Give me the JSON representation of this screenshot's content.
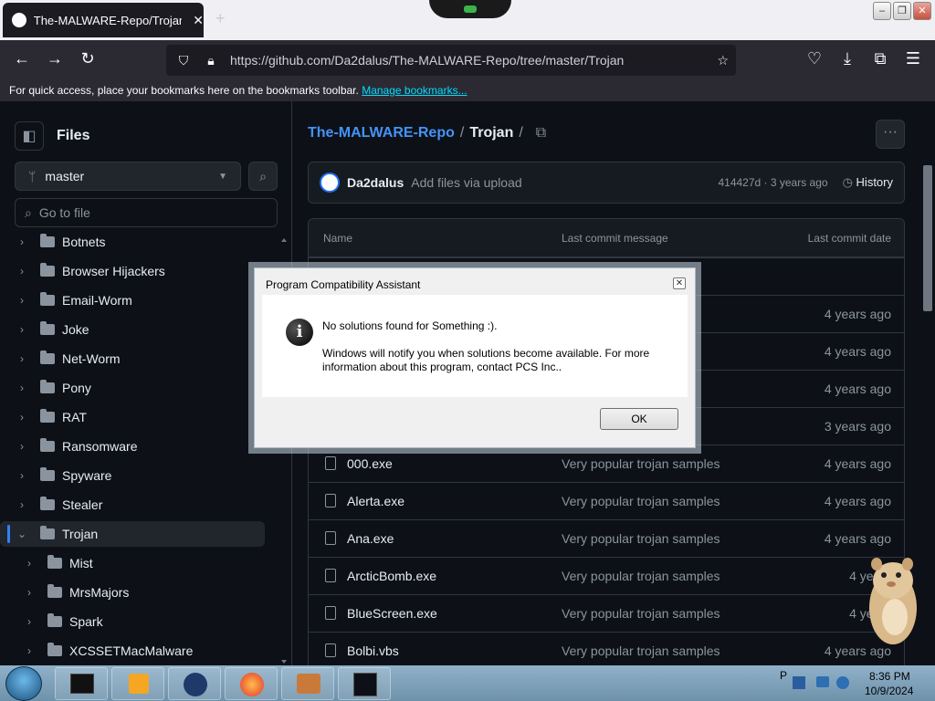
{
  "browser": {
    "tab_title": "The-MALWARE-Repo/Trojan at",
    "new_tab_symbol": "+",
    "url": "https://github.com/Da2dalus/The-MALWARE-Repo/tree/master/Trojan",
    "bookmarks_text": "For quick access, place your bookmarks here on the bookmarks toolbar.",
    "bookmarks_link": "Manage bookmarks..."
  },
  "sidebar": {
    "title": "Files",
    "branch": "master",
    "goto_placeholder": "Go to file",
    "items": [
      {
        "label": "Botnets",
        "depth": 0
      },
      {
        "label": "Browser Hijackers",
        "depth": 0
      },
      {
        "label": "Email-Worm",
        "depth": 0
      },
      {
        "label": "Joke",
        "depth": 0
      },
      {
        "label": "Net-Worm",
        "depth": 0
      },
      {
        "label": "Pony",
        "depth": 0
      },
      {
        "label": "RAT",
        "depth": 0
      },
      {
        "label": "Ransomware",
        "depth": 0
      },
      {
        "label": "Spyware",
        "depth": 0
      },
      {
        "label": "Stealer",
        "depth": 0
      },
      {
        "label": "Trojan",
        "depth": 0,
        "expanded": true,
        "selected": true
      },
      {
        "label": "Mist",
        "depth": 1
      },
      {
        "label": "MrsMajors",
        "depth": 1
      },
      {
        "label": "Spark",
        "depth": 1
      },
      {
        "label": "XCSSETMacMalware",
        "depth": 1
      }
    ]
  },
  "main": {
    "repo": "The-MALWARE-Repo",
    "separator": "/",
    "folder": "Trojan",
    "commit": {
      "user": "Da2dalus",
      "message": "Add files via upload",
      "sha_time": "414427d · 3 years ago",
      "history": "History"
    },
    "table_headers": {
      "name": "Name",
      "message": "Last commit message",
      "date": "Last commit date"
    },
    "rows": [
      {
        "name": "",
        "message": "",
        "date": ""
      },
      {
        "name": "",
        "message": "mples",
        "date": "4 years ago"
      },
      {
        "name": "",
        "message": "",
        "date": "4 years ago"
      },
      {
        "name": "",
        "message": "mples",
        "date": "4 years ago"
      },
      {
        "name": "",
        "message": "",
        "date": "3 years ago"
      },
      {
        "name": "000.exe",
        "message": "Very popular trojan samples",
        "date": "4 years ago"
      },
      {
        "name": "Alerta.exe",
        "message": "Very popular trojan samples",
        "date": "4 years ago"
      },
      {
        "name": "Ana.exe",
        "message": "Very popular trojan samples",
        "date": "4 years ago"
      },
      {
        "name": "ArcticBomb.exe",
        "message": "Very popular trojan samples",
        "date": "4 years"
      },
      {
        "name": "BlueScreen.exe",
        "message": "Very popular trojan samples",
        "date": "4 years"
      },
      {
        "name": "Bolbi.vbs",
        "message": "Very popular trojan samples",
        "date": "4 years ago"
      }
    ]
  },
  "dialog": {
    "title": "Program Compatibility Assistant",
    "close": "✕",
    "message1": "No solutions found for Something :).",
    "message2": "Windows will notify you when solutions become available. For more information about this program, contact PCS Inc..",
    "ok": "OK"
  },
  "taskbar": {
    "time": "8:36 PM",
    "date": "10/9/2024",
    "tray_letter": "P"
  }
}
